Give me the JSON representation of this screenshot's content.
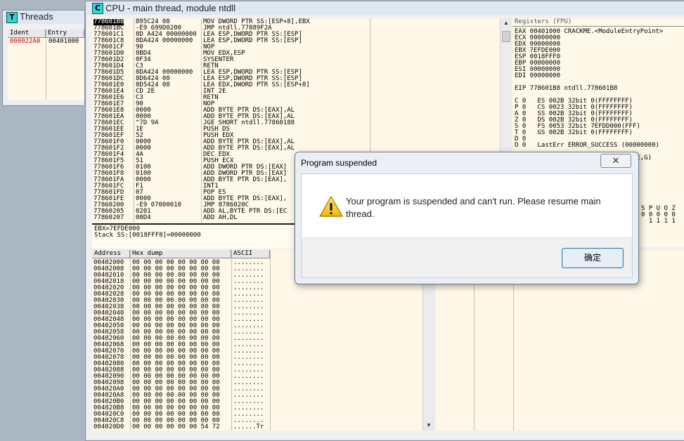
{
  "threads": {
    "title": "Threads",
    "icon_letter": "T",
    "columns": [
      "Ident",
      "Entry"
    ],
    "rows": [
      {
        "ident": "000022A0",
        "entry": "00401000"
      }
    ]
  },
  "cpu": {
    "title": "CPU - main thread, module ntdll",
    "icon_letter": "C",
    "disasm": [
      {
        "addr": "778601B8",
        "hex": "895C24 08",
        "code": "MOV DWORD PTR SS:[ESP+8],EBX",
        "selected": true
      },
      {
        "addr": "778601BC",
        "hex": "-E9 699D0200",
        "code": "JMP ntdll.77889F2A"
      },
      {
        "addr": "778601C1",
        "hex": "8D A424 00000000",
        "code": "LEA ESP,DWORD PTR SS:[ESP]"
      },
      {
        "addr": "778601C8",
        "hex": "8DA424 00000000",
        "code": "LEA ESP,DWORD PTR SS:[ESP]"
      },
      {
        "addr": "778601CF",
        "hex": "90",
        "code": "NOP"
      },
      {
        "addr": "778601D0",
        "hex": "8BD4",
        "code": "MOV EDX,ESP"
      },
      {
        "addr": "778601D2",
        "hex": "0F34",
        "code": "SYSENTER"
      },
      {
        "addr": "778601D4",
        "hex": "C3",
        "code": "RETN"
      },
      {
        "addr": "778601D5",
        "hex": "8DA424 00000000",
        "code": "LEA ESP,DWORD PTR SS:[ESP]"
      },
      {
        "addr": "778601DC",
        "hex": "8D6424 00",
        "code": "LEA ESP,DWORD PTR SS:[ESP]"
      },
      {
        "addr": "778601E0",
        "hex": "8D5424 08",
        "code": "LEA EDX,DWORD PTR SS:[ESP+8]"
      },
      {
        "addr": "778601E4",
        "hex": "CD 2E",
        "code": "INT 2E"
      },
      {
        "addr": "778601E6",
        "hex": "C3",
        "code": "RETN"
      },
      {
        "addr": "778601E7",
        "hex": "90",
        "code": "NOP"
      },
      {
        "addr": "778601E8",
        "hex": "0000",
        "code": "ADD BYTE PTR DS:[EAX],AL"
      },
      {
        "addr": "778601EA",
        "hex": "0000",
        "code": "ADD BYTE PTR DS:[EAX],AL"
      },
      {
        "addr": "778601EC",
        "hex": "^7D 9A",
        "code": "JGE SHORT ntdll.77860188"
      },
      {
        "addr": "778601EE",
        "hex": "1E",
        "code": "PUSH DS"
      },
      {
        "addr": "778601EF",
        "hex": "52",
        "code": "PUSH EDX"
      },
      {
        "addr": "778601F0",
        "hex": "0000",
        "code": "ADD BYTE PTR DS:[EAX],AL"
      },
      {
        "addr": "778601F2",
        "hex": "0000",
        "code": "ADD BYTE PTR DS:[EAX],AL"
      },
      {
        "addr": "778601F4",
        "hex": "4A",
        "code": "DEC EDX"
      },
      {
        "addr": "778601F5",
        "hex": "51",
        "code": "PUSH ECX"
      },
      {
        "addr": "778601F6",
        "hex": "0100",
        "code": "ADD DWORD PTR DS:[EAX]"
      },
      {
        "addr": "778601F8",
        "hex": "0100",
        "code": "ADD DWORD PTR DS:[EAX]"
      },
      {
        "addr": "778601FA",
        "hex": "0000",
        "code": "ADD BYTE PTR DS:[EAX],"
      },
      {
        "addr": "778601FC",
        "hex": "F1",
        "code": "INT1"
      },
      {
        "addr": "778601FD",
        "hex": "07",
        "code": "POP ES"
      },
      {
        "addr": "778601FE",
        "hex": "0000",
        "code": "ADD BYTE PTR DS:[EAX],"
      },
      {
        "addr": "77860200",
        "hex": "-E9 07000010",
        "code": "JMP 8786020C"
      },
      {
        "addr": "77860205",
        "hex": "0201",
        "code": "ADD AL,BYTE PTR DS:[EC"
      },
      {
        "addr": "77860207",
        "hex": "00D4",
        "code": "ADD AH,DL"
      }
    ],
    "info_lines": [
      "EBX=7EFDE000",
      "Stack SS:[0018FFF8]=00000000"
    ],
    "registers_header": "Registers (FPU)",
    "registers": [
      "EAX 00401000 CRACKME.<ModuleEntryPoint>",
      "ECX 00000000",
      "EDX 00000000",
      "EBX 7EFDE000",
      "ESP 0018FFF0",
      "EBP 00000000",
      "ESI 00000000",
      "EDI 00000000",
      "",
      "EIP 778601B8 ntdll.778601B8",
      "",
      "C 0   ES 002B 32bit 0(FFFFFFFF)",
      "P 0   CS 0023 32bit 0(FFFFFFFF)",
      "A 0   SS 002B 32bit 0(FFFFFFFF)",
      "Z 0   DS 002B 32bit 0(FFFFFFFF)",
      "S 0   FS 0053 32bit 7EFDD000(FFF)",
      "T 0   GS 002B 32bit 0(FFFFFFFF)",
      "D 0",
      "O 0   LastErr ERROR_SUCCESS (00000000)",
      "",
      "EFL 00000202 (NO,NB,NE,A,NS,PO,GE,G)"
    ],
    "fpu_flags": [
      "S P U O Z",
      "0 0 0 0 0",
      "  1 1 1 1"
    ],
    "dump_headers": [
      "Address",
      "Hex dump",
      "ASCII"
    ],
    "dump_rows": [
      {
        "addr": "00402000",
        "hex": "00 00 00 00 00 00 00 00",
        "ascii": "........"
      },
      {
        "addr": "00402008",
        "hex": "00 00 00 00 00 00 00 00",
        "ascii": "........"
      },
      {
        "addr": "00402010",
        "hex": "00 00 00 00 00 00 00 00",
        "ascii": "........"
      },
      {
        "addr": "00402018",
        "hex": "00 00 00 00 00 00 00 00",
        "ascii": "........"
      },
      {
        "addr": "00402020",
        "hex": "00 00 00 00 00 00 00 00",
        "ascii": "........"
      },
      {
        "addr": "00402028",
        "hex": "00 00 00 00 00 00 00 00",
        "ascii": "........"
      },
      {
        "addr": "00402030",
        "hex": "00 00 00 00 00 00 00 00",
        "ascii": "........"
      },
      {
        "addr": "00402038",
        "hex": "00 00 00 00 00 00 00 00",
        "ascii": "........"
      },
      {
        "addr": "00402040",
        "hex": "00 00 00 00 00 00 00 00",
        "ascii": "........"
      },
      {
        "addr": "00402048",
        "hex": "00 00 00 00 00 00 00 00",
        "ascii": "........"
      },
      {
        "addr": "00402050",
        "hex": "00 00 00 00 00 00 00 00",
        "ascii": "........"
      },
      {
        "addr": "00402058",
        "hex": "00 00 00 00 00 00 00 00",
        "ascii": "........"
      },
      {
        "addr": "00402060",
        "hex": "00 00 00 00 00 00 00 00",
        "ascii": "........"
      },
      {
        "addr": "00402068",
        "hex": "00 00 00 00 00 00 00 00",
        "ascii": "........"
      },
      {
        "addr": "00402070",
        "hex": "00 00 00 00 00 00 00 00",
        "ascii": "........"
      },
      {
        "addr": "00402078",
        "hex": "00 00 00 00 00 00 00 00",
        "ascii": "........"
      },
      {
        "addr": "00402080",
        "hex": "00 00 00 00 00 00 00 00",
        "ascii": "........"
      },
      {
        "addr": "00402088",
        "hex": "00 00 00 00 00 00 00 00",
        "ascii": "........"
      },
      {
        "addr": "00402090",
        "hex": "00 00 00 00 00 00 00 00",
        "ascii": "........"
      },
      {
        "addr": "00402098",
        "hex": "00 00 00 00 00 00 00 00",
        "ascii": "........"
      },
      {
        "addr": "004020A0",
        "hex": "00 00 00 00 00 00 00 00",
        "ascii": "........"
      },
      {
        "addr": "004020A8",
        "hex": "00 00 00 00 00 00 00 00",
        "ascii": "........"
      },
      {
        "addr": "004020B0",
        "hex": "00 00 00 00 00 00 00 00",
        "ascii": "........"
      },
      {
        "addr": "004020B8",
        "hex": "00 00 00 00 00 00 00 00",
        "ascii": "........"
      },
      {
        "addr": "004020C0",
        "hex": "00 00 00 00 00 00 00 00",
        "ascii": "........"
      },
      {
        "addr": "004020C8",
        "hex": "00 00 00 00 00 00 00 00",
        "ascii": "........"
      },
      {
        "addr": "004020D0",
        "hex": "00 00 00 00 00 00 54 72",
        "ascii": "......Tr"
      }
    ]
  },
  "dialog": {
    "title": "Program suspended",
    "close_glyph": "✕",
    "message": "Your program is suspended and can't run. Please resume main thread.",
    "ok_label": "确定"
  }
}
